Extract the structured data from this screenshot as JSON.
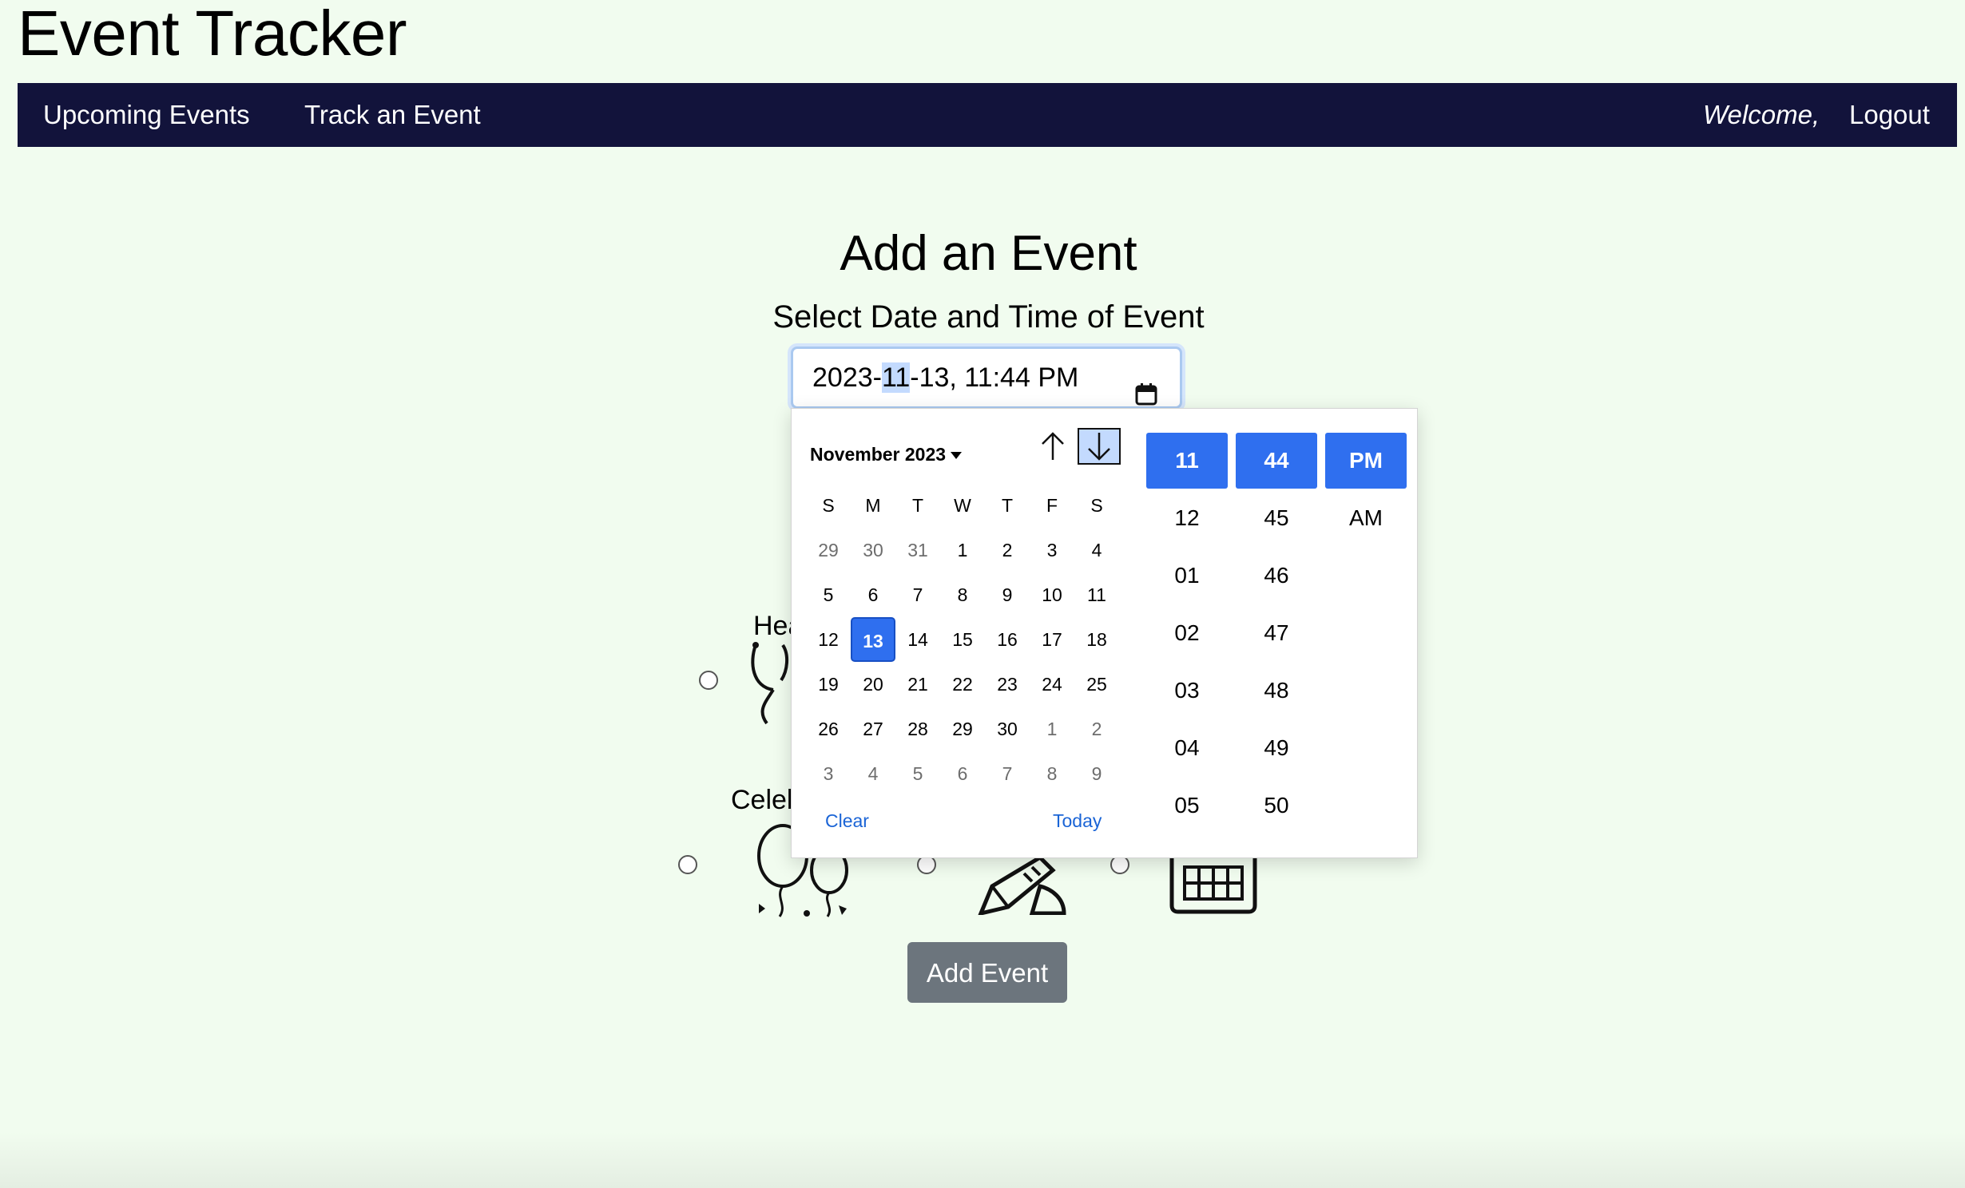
{
  "app": {
    "title": "Event Tracker"
  },
  "nav": {
    "upcoming": "Upcoming Events",
    "track": "Track an Event",
    "welcome": "Welcome,",
    "logout": "Logout"
  },
  "page": {
    "heading": "Add an Event",
    "subheading": "Select Date and Time of Event"
  },
  "datetime_input": {
    "year": "2023",
    "sep1": "-",
    "month": "11",
    "sep2": "-",
    "day_and_time": "13, 11:44",
    "ampm": "PM"
  },
  "categories": {
    "health_partial": "Hea",
    "celebration_partial": "Celeb"
  },
  "picker": {
    "month_label": "November 2023",
    "weekdays": [
      "S",
      "M",
      "T",
      "W",
      "T",
      "F",
      "S"
    ],
    "weeks": [
      [
        "29",
        "30",
        "31",
        "1",
        "2",
        "3",
        "4"
      ],
      [
        "5",
        "6",
        "7",
        "8",
        "9",
        "10",
        "11"
      ],
      [
        "12",
        "13",
        "14",
        "15",
        "16",
        "17",
        "18"
      ],
      [
        "19",
        "20",
        "21",
        "22",
        "23",
        "24",
        "25"
      ],
      [
        "26",
        "27",
        "28",
        "29",
        "30",
        "1",
        "2"
      ],
      [
        "3",
        "4",
        "5",
        "6",
        "7",
        "8",
        "9"
      ]
    ],
    "selected_day": "13",
    "clear_label": "Clear",
    "today_label": "Today",
    "hours": [
      "11",
      "12",
      "01",
      "02",
      "03",
      "04",
      "05"
    ],
    "minutes": [
      "44",
      "45",
      "46",
      "47",
      "48",
      "49",
      "50"
    ],
    "ampm": [
      "PM",
      "AM"
    ]
  },
  "actions": {
    "add_event": "Add Event"
  },
  "colors": {
    "background": "#f1fcef",
    "navbar": "#12133b",
    "accent": "#2f6fef",
    "button": "#6c757d",
    "link": "#1a64d6"
  }
}
